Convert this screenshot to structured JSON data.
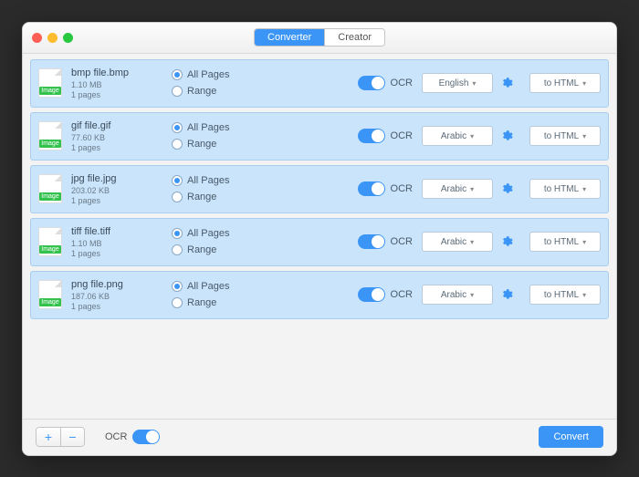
{
  "window": {
    "traffic": {
      "close": "#ff5f57",
      "min": "#febc2e",
      "max": "#28c840"
    },
    "tabs": {
      "converter": "Converter",
      "creator": "Creator",
      "active": "converter"
    }
  },
  "labels": {
    "all_pages": "All Pages",
    "range": "Range",
    "ocr": "OCR",
    "image_tag": "Image"
  },
  "files": [
    {
      "name": "bmp file.bmp",
      "size": "1.10 MB",
      "pages": "1 pages",
      "language": "English",
      "format": "to HTML"
    },
    {
      "name": "gif file.gif",
      "size": "77.60 KB",
      "pages": "1 pages",
      "language": "Arabic",
      "format": "to HTML"
    },
    {
      "name": "jpg file.jpg",
      "size": "203.02 KB",
      "pages": "1 pages",
      "language": "Arabic",
      "format": "to HTML"
    },
    {
      "name": "tiff file.tiff",
      "size": "1.10 MB",
      "pages": "1 pages",
      "language": "Arabic",
      "format": "to HTML"
    },
    {
      "name": "png file.png",
      "size": "187.06 KB",
      "pages": "1 pages",
      "language": "Arabic",
      "format": "to HTML"
    }
  ],
  "footer": {
    "add": "+",
    "remove": "−",
    "ocr_label": "OCR",
    "convert": "Convert"
  }
}
